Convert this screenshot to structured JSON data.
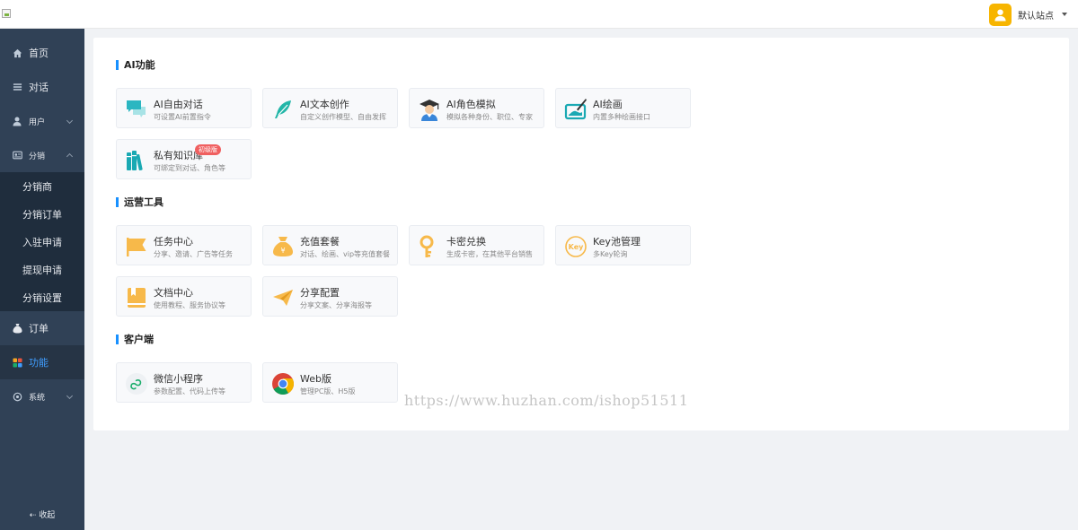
{
  "header": {
    "user_name": "默认站点",
    "avatar_icon": "user-icon",
    "avatar_color": "#f7b500"
  },
  "sidebar": {
    "items": [
      {
        "label": "首页",
        "icon": "home-icon"
      },
      {
        "label": "对话",
        "icon": "list-icon"
      },
      {
        "label": "用户",
        "icon": "user-icon"
      },
      {
        "label": "分销",
        "icon": "distribution-icon"
      },
      {
        "label": "订单",
        "icon": "money-bag-icon"
      },
      {
        "label": "功能",
        "icon": "grid-icon"
      },
      {
        "label": "系统",
        "icon": "settings-icon"
      }
    ],
    "sub_items": [
      "分销商",
      "分销订单",
      "入驻申请",
      "提现申请",
      "分销设置"
    ],
    "collapse_label": "⇠ 收起",
    "background": "#304156",
    "active_color": "#409eff"
  },
  "sections": [
    {
      "title": "AI功能",
      "tiles": [
        {
          "title": "AI自由对话",
          "desc": "可设置AI前置指令",
          "icon": "chat-bubbles-icon"
        },
        {
          "title": "AI文本创作",
          "desc": "自定义创作模型、自由发挥",
          "icon": "feather-icon"
        },
        {
          "title": "AI角色模拟",
          "desc": "模拟各种身份、职位、专家",
          "icon": "graduate-icon"
        },
        {
          "title": "AI绘画",
          "desc": "内置多种绘画接口",
          "icon": "drawing-board-icon"
        },
        {
          "title": "私有知识库",
          "desc": "可绑定到对话、角色等",
          "icon": "books-icon",
          "badge": "初级版"
        }
      ]
    },
    {
      "title": "运营工具",
      "tiles": [
        {
          "title": "任务中心",
          "desc": "分享、邀请、广告等任务",
          "icon": "flag-icon"
        },
        {
          "title": "充值套餐",
          "desc": "对话、绘画、vip等充值套餐",
          "icon": "money-bag-icon"
        },
        {
          "title": "卡密兑换",
          "desc": "生成卡密，在其他平台销售",
          "icon": "key-icon"
        },
        {
          "title": "Key池管理",
          "desc": "多Key轮询",
          "icon": "key-circle-icon",
          "icon_text": "Key"
        },
        {
          "title": "文档中心",
          "desc": "使用教程、服务协议等",
          "icon": "book-icon"
        },
        {
          "title": "分享配置",
          "desc": "分享文案、分享海报等",
          "icon": "paper-plane-icon"
        }
      ]
    },
    {
      "title": "客户端",
      "tiles": [
        {
          "title": "微信小程序",
          "desc": "参数配置、代码上传等",
          "icon": "mini-program-icon"
        },
        {
          "title": "Web版",
          "desc": "管理PC版、H5版",
          "icon": "chrome-icon"
        }
      ]
    }
  ],
  "watermark": "https://www.huzhan.com/ishop51511"
}
